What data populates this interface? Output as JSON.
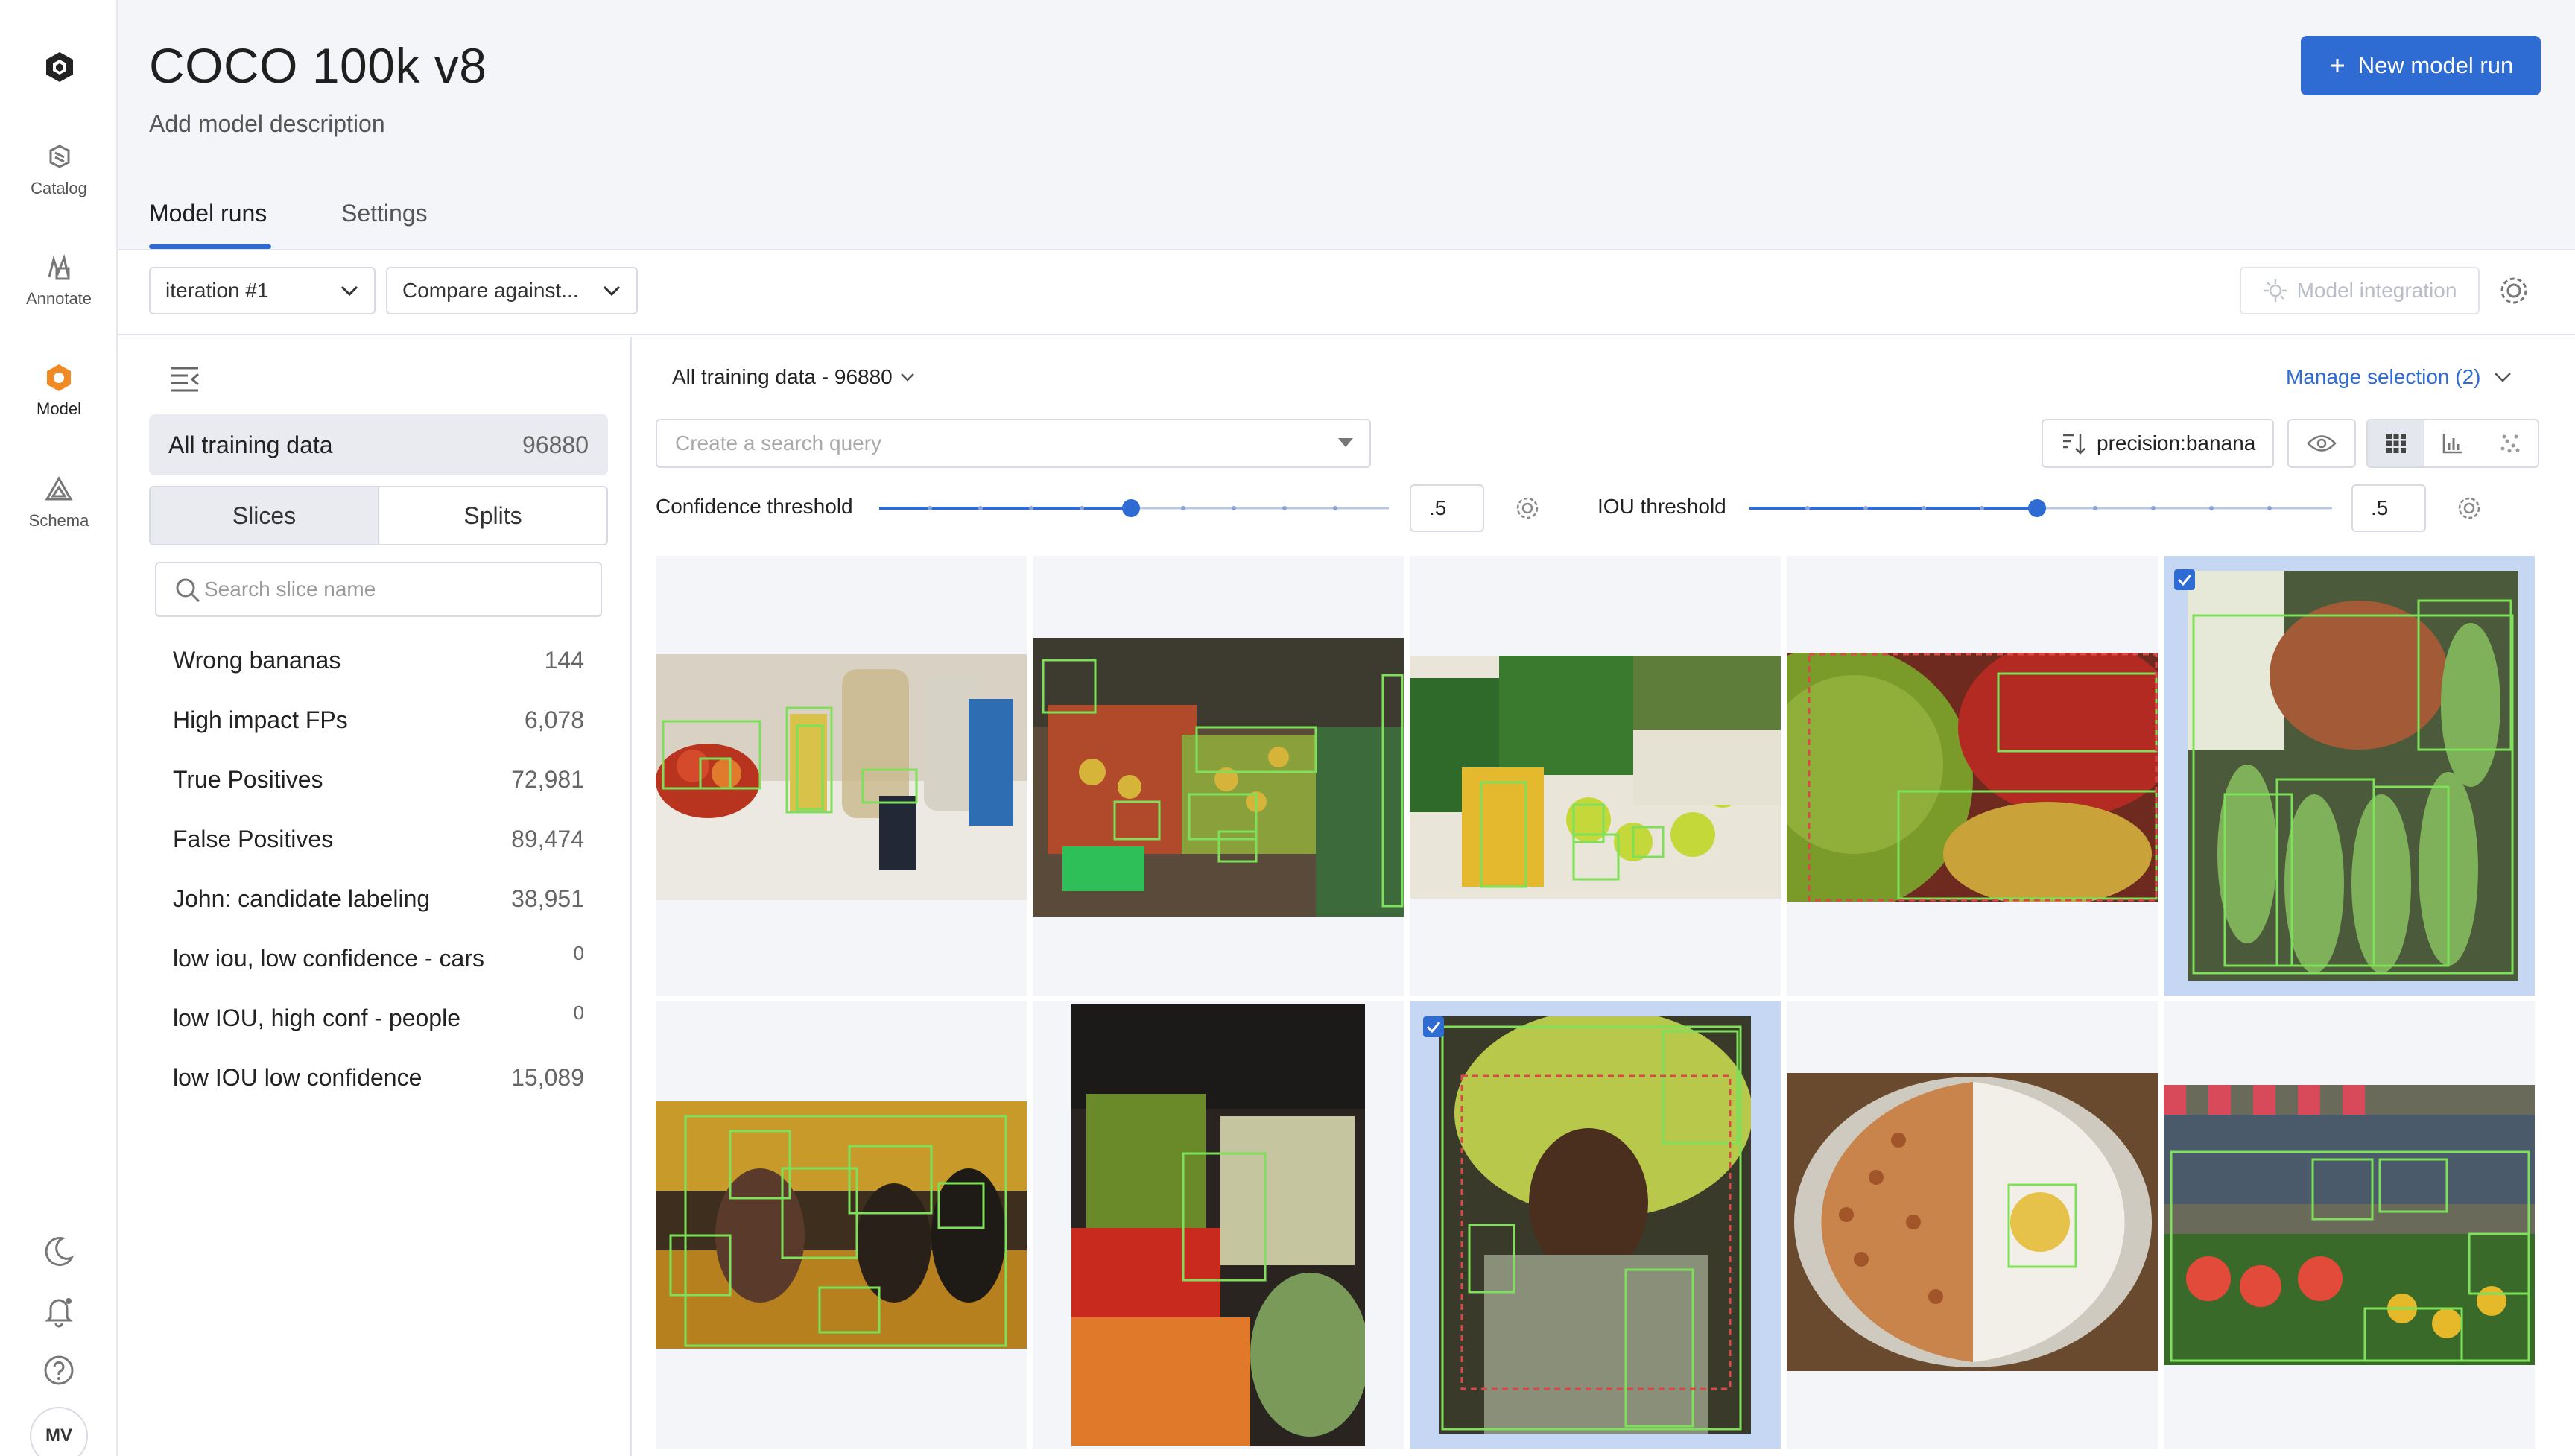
{
  "nav": {
    "items": [
      {
        "label": "Catalog",
        "icon": "catalog-icon"
      },
      {
        "label": "Annotate",
        "icon": "annotate-icon"
      },
      {
        "label": "Model",
        "icon": "model-icon",
        "active": true
      },
      {
        "label": "Schema",
        "icon": "schema-icon"
      }
    ],
    "avatar": "MV"
  },
  "header": {
    "title": "COCO 100k v8",
    "description": "Add model description",
    "new_run_label": "New model run",
    "tabs": [
      {
        "label": "Model runs",
        "active": true
      },
      {
        "label": "Settings"
      }
    ]
  },
  "toolbar": {
    "iteration": "iteration #1",
    "compare": "Compare against...",
    "model_integration": "Model integration"
  },
  "left_panel": {
    "all_training": {
      "label": "All training data",
      "count": "96880"
    },
    "segments": [
      "Slices",
      "Splits"
    ],
    "search_placeholder": "Search slice name",
    "slices": [
      {
        "name": "Wrong bananas",
        "count": "144"
      },
      {
        "name": "High impact FPs",
        "count": "6,078"
      },
      {
        "name": "True Positives",
        "count": "72,981"
      },
      {
        "name": "False Positives",
        "count": "89,474"
      },
      {
        "name": "John: candidate labeling",
        "count": "38,951"
      },
      {
        "name": "low iou, low confidence - cars",
        "count": "0"
      },
      {
        "name": "low IOU, high conf - people",
        "count": "0"
      },
      {
        "name": "low IOU low confidence",
        "count": "15,089"
      }
    ]
  },
  "main": {
    "data_title": "All training data - 96880",
    "manage_selection": "Manage selection (2)",
    "search_placeholder": "Create a search query",
    "sort_label": "precision:banana",
    "confidence": {
      "label": "Confidence threshold",
      "value": ".5",
      "level": 0.5
    },
    "iou": {
      "label": "IOU threshold",
      "value": ".5",
      "level": 0.5
    }
  },
  "colors": {
    "accent": "#2e6bd2",
    "bbox_pred": "#7ee05a",
    "bbox_gt": "#d84a4a",
    "selected_tile": "#c5d7f3"
  }
}
